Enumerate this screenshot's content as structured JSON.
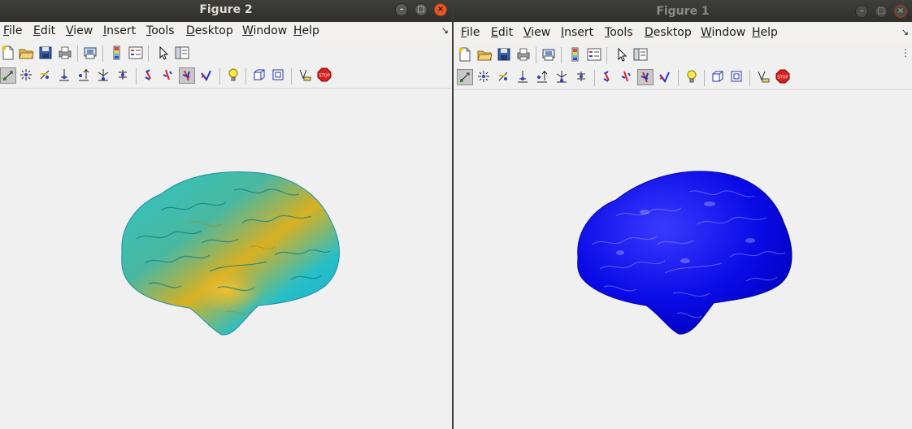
{
  "figure2": {
    "title": "Figure 2",
    "window_buttons": [
      "minimize",
      "maximize",
      "close"
    ],
    "menu": [
      "File",
      "Edit",
      "View",
      "Insert",
      "Tools",
      "Desktop",
      "Window",
      "Help"
    ],
    "menu_mnemonics": [
      "F",
      "E",
      "V",
      "I",
      "T",
      "D",
      "W",
      "H"
    ]
  },
  "figure1": {
    "title": "Figure 1",
    "window_buttons": [
      "minimize",
      "maximize",
      "close"
    ],
    "menu": [
      "File",
      "Edit",
      "View",
      "Insert",
      "Tools",
      "Desktop",
      "Window",
      "Help"
    ],
    "menu_mnemonics": [
      "F",
      "E",
      "V",
      "I",
      "T",
      "D",
      "W",
      "H"
    ]
  },
  "toolbar_row1": [
    "new-figure-icon",
    "open-file-icon",
    "save-icon",
    "print-icon",
    "print-preview-icon",
    "insert-colorbar-icon",
    "insert-legend-icon",
    "edit-plot-icon",
    "property-editor-icon"
  ],
  "toolbar_row2": [
    "select-mode-icon",
    "select-points-icon",
    "select-line-icon",
    "select-area-icon",
    "select-path-icon",
    "select-label-icon",
    "rotate-x-icon",
    "rotate-y-icon",
    "rotate-z-icon",
    "rotate-free-icon",
    "light-bulb-icon",
    "box-view-icon",
    "cube-view-icon",
    "annotate-icon",
    "stop-icon"
  ],
  "surfaces": {
    "figure2_colormap": "parula",
    "figure1_color": "#0000e0"
  }
}
